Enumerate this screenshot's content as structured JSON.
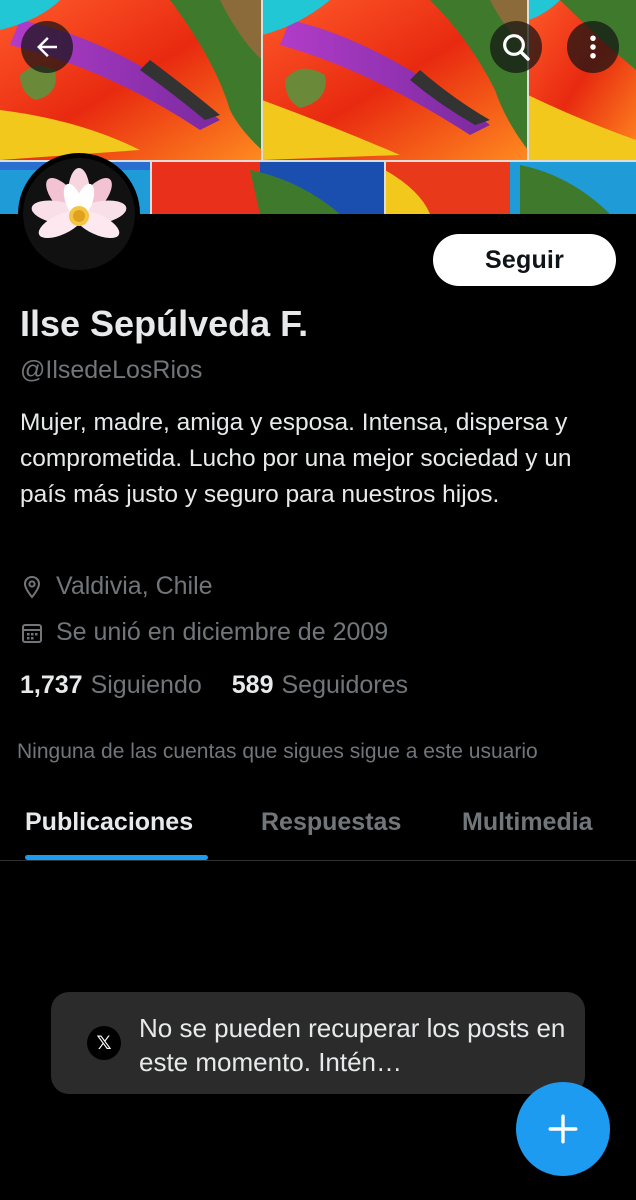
{
  "header": {
    "back_icon": "arrow-left-icon",
    "search_icon": "search-icon",
    "more_icon": "more-vertical-icon"
  },
  "profile": {
    "avatar_icon": "lotus-flower-avatar",
    "follow_label": "Seguir",
    "name": "Ilse Sepúlveda F.",
    "handle": "@IlsedeLosRios",
    "bio": "Mujer, madre, amiga y esposa. Intensa, dispersa y comprometida. Lucho por una mejor sociedad y un país más justo y seguro para nuestros hijos.",
    "location": "Valdivia, Chile",
    "joined": "Se unió en diciembre de 2009",
    "following_count": "1,737",
    "following_label": "Siguiendo",
    "followers_count": "589",
    "followers_label": "Seguidores",
    "mutual_note": "Ninguna de las cuentas que sigues sigue a este usuario"
  },
  "tabs": [
    {
      "label": "Publicaciones",
      "active": true
    },
    {
      "label": "Respuestas",
      "active": false
    },
    {
      "label": "Multimedia",
      "active": false
    }
  ],
  "toast": {
    "icon": "x-logo-icon",
    "logo_text": "𝕏",
    "message": "No se pueden recuperar los posts en este momento. Intén…"
  },
  "fab": {
    "icon": "plus-icon"
  },
  "colors": {
    "background": "#000000",
    "accent": "#1d9bf0",
    "text_primary": "#e7e9ea",
    "text_secondary": "#71767b",
    "toast_bg": "#2b2b2b"
  }
}
